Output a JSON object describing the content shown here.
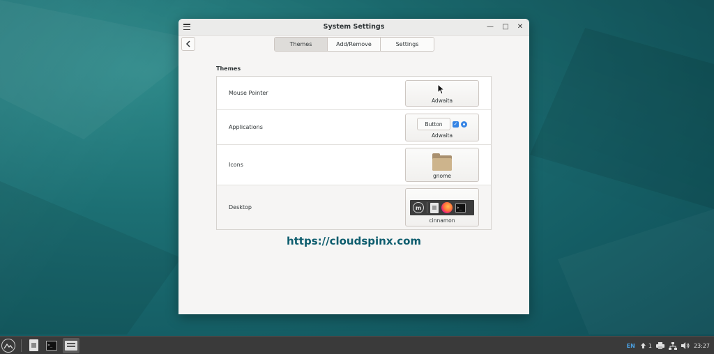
{
  "window": {
    "title": "System Settings"
  },
  "tabs": [
    {
      "label": "Themes",
      "active": true
    },
    {
      "label": "Add/Remove",
      "active": false
    },
    {
      "label": "Settings",
      "active": false
    }
  ],
  "section": {
    "title": "Themes"
  },
  "rows": [
    {
      "label": "Mouse Pointer",
      "value": "Adwaita"
    },
    {
      "label": "Applications",
      "value": "Adwaita",
      "preview_button": "Button"
    },
    {
      "label": "Icons",
      "value": "gnome"
    },
    {
      "label": "Desktop",
      "value": "cinnamon"
    }
  ],
  "watermark": "https://cloudspinx.com",
  "taskbar": {
    "launchers": [
      "files-icon",
      "terminal-icon",
      "settings-icon"
    ],
    "tray": {
      "language": "EN",
      "notification_count": "1",
      "clock": "23:27"
    }
  },
  "colors": {
    "accent": "#3584e4",
    "watermark": "#0e5d6e",
    "desktop": "#1c6f73"
  }
}
